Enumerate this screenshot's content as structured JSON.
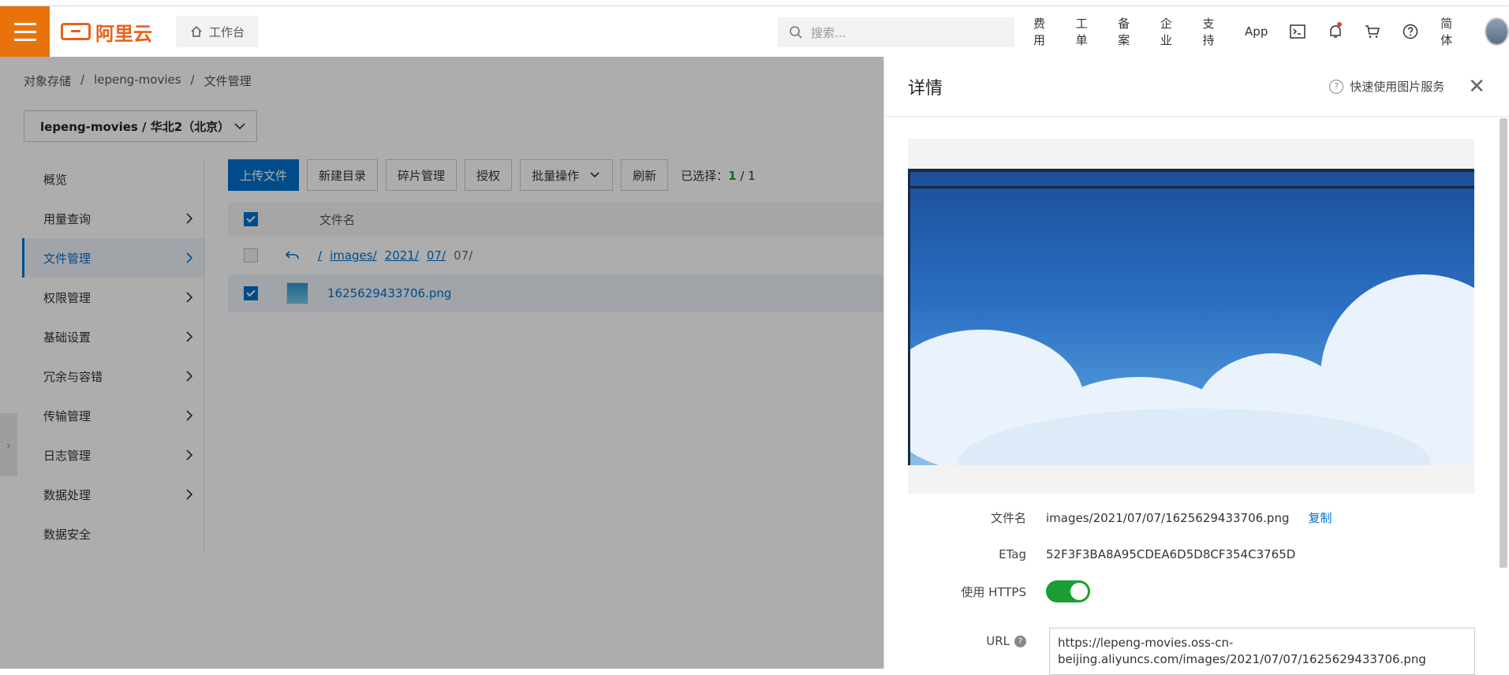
{
  "header": {
    "logo_text": "阿里云",
    "workbench_label": "工作台",
    "search_placeholder": "搜索...",
    "nav": [
      "费用",
      "工单",
      "备案",
      "企业",
      "支持",
      "App"
    ],
    "lang": "简体"
  },
  "breadcrumb": {
    "items": [
      "对象存储",
      "lepeng-movies",
      "文件管理"
    ],
    "sep": "/"
  },
  "bucket_selector": "lepeng-movies / 华北2（北京）",
  "left_nav": [
    {
      "label": "概览",
      "arrow": false
    },
    {
      "label": "用量查询",
      "arrow": true
    },
    {
      "label": "文件管理",
      "arrow": true,
      "active": true
    },
    {
      "label": "权限管理",
      "arrow": true
    },
    {
      "label": "基础设置",
      "arrow": true
    },
    {
      "label": "冗余与容错",
      "arrow": true
    },
    {
      "label": "传输管理",
      "arrow": true
    },
    {
      "label": "日志管理",
      "arrow": true
    },
    {
      "label": "数据处理",
      "arrow": true
    },
    {
      "label": "数据安全",
      "arrow": false
    }
  ],
  "toolbar": {
    "upload": "上传文件",
    "new_dir": "新建目录",
    "fragments": "碎片管理",
    "auth": "授权",
    "batch": "批量操作",
    "refresh": "刷新",
    "selected_label": "已选择：",
    "selected_count": "1",
    "selected_total": "/ 1"
  },
  "table": {
    "col_name": "文件名",
    "path_links": [
      "/",
      "images/",
      "2021/",
      "07/"
    ],
    "path_current": "07/",
    "file_name": "1625629433706.png"
  },
  "drawer": {
    "title": "详情",
    "help": "快速使用图片服务",
    "fields": {
      "filename_label": "文件名",
      "filename_value": "images/2021/07/07/1625629433706.png",
      "copy": "复制",
      "etag_label": "ETag",
      "etag_value": "52F3F3BA8A95CDEA6D5D8CF354C3765D",
      "https_label": "使用 HTTPS",
      "https_on": true,
      "url_label": "URL",
      "url_value": "https://lepeng-movies.oss-cn-beijing.aliyuncs.com/images/2021/07/07/1625629433706.png"
    }
  },
  "colors": {
    "brand": "#e8730c",
    "primary": "#0070cc",
    "success": "#1a9e32"
  }
}
